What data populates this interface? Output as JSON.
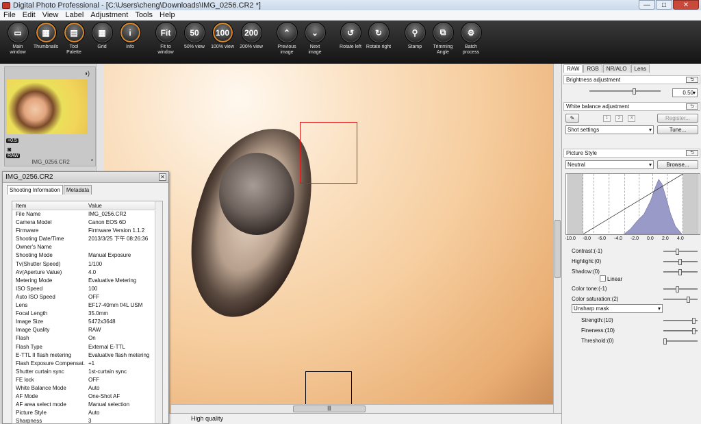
{
  "window": {
    "title": "Digital Photo Professional - [C:\\Users\\cheng\\Downloads\\IMG_0256.CR2 *]",
    "minimize": "—",
    "maximize": "□",
    "close": "✕"
  },
  "menu": [
    "File",
    "Edit",
    "View",
    "Label",
    "Adjustment",
    "Tools",
    "Help"
  ],
  "toolbar": [
    {
      "label": "Main\nwindow",
      "icon": "main-window-icon",
      "glyph": "▭"
    },
    {
      "label": "Thumbnails",
      "icon": "thumbnails-icon",
      "glyph": "▦",
      "active": true
    },
    {
      "label": "Tool\nPalette",
      "icon": "tool-palette-icon",
      "glyph": "▤",
      "active": true
    },
    {
      "label": "Grid",
      "icon": "grid-icon",
      "glyph": "▦"
    },
    {
      "label": "Info",
      "icon": "info-icon",
      "glyph": "i",
      "active": true
    },
    {
      "label": "Fit to\nwindow",
      "icon": "fit-to-window-icon",
      "glyph": "Fit"
    },
    {
      "label": "50% view",
      "icon": "zoom-50-icon",
      "glyph": "50"
    },
    {
      "label": "100% view",
      "icon": "zoom-100-icon",
      "glyph": "100",
      "active": true
    },
    {
      "label": "200% view",
      "icon": "zoom-200-icon",
      "glyph": "200"
    },
    {
      "label": "Previous\nimage",
      "icon": "previous-image-icon",
      "glyph": "⌃"
    },
    {
      "label": "Next\nimage",
      "icon": "next-image-icon",
      "glyph": "⌄"
    },
    {
      "label": "Rotate left",
      "icon": "rotate-left-icon",
      "glyph": "↺"
    },
    {
      "label": "Rotate right",
      "icon": "rotate-right-icon",
      "glyph": "↻"
    },
    {
      "label": "Stamp",
      "icon": "stamp-icon",
      "glyph": "⚲"
    },
    {
      "label": "Trimming\nAngle",
      "icon": "trimming-angle-icon",
      "glyph": "⧉"
    },
    {
      "label": "Batch\nprocess",
      "icon": "batch-process-icon",
      "glyph": "⚙"
    }
  ],
  "thumbnail": {
    "name": "IMG_0256.CR2",
    "exposure_badge": "+0.5",
    "raw_badge": "RAW",
    "star": "*"
  },
  "info_panel": {
    "title": "IMG_0256.CR2",
    "tabs": [
      "Shooting Information",
      "Metadata"
    ],
    "columns": [
      "Item",
      "Value"
    ],
    "rows": [
      [
        "File Name",
        "IMG_0256.CR2"
      ],
      [
        "Camera Model",
        "Canon EOS 6D"
      ],
      [
        "Firmware",
        "Firmware Version 1.1.2"
      ],
      [
        "Shooting Date/Time",
        "2013/3/25 下午 08:26:36"
      ],
      [
        "Owner's Name",
        ""
      ],
      [
        "Shooting Mode",
        "Manual Exposure"
      ],
      [
        "Tv(Shutter Speed)",
        "1/100"
      ],
      [
        "Av(Aperture Value)",
        "4.0"
      ],
      [
        "Metering Mode",
        "Evaluative Metering"
      ],
      [
        "ISO Speed",
        "100"
      ],
      [
        "Auto ISO Speed",
        "OFF"
      ],
      [
        "Lens",
        "EF17-40mm f/4L USM"
      ],
      [
        "Focal Length",
        "35.0mm"
      ],
      [
        "Image Size",
        "5472x3648"
      ],
      [
        "Image Quality",
        "RAW"
      ],
      [
        "Flash",
        "On"
      ],
      [
        "Flash Type",
        "External E-TTL"
      ],
      [
        "E-TTL II flash metering",
        "Evaluative flash metering"
      ],
      [
        "Flash Exposure Compensat...",
        "+1"
      ],
      [
        "Shutter curtain sync",
        "1st-curtain sync"
      ],
      [
        "FE lock",
        "OFF"
      ],
      [
        "White Balance Mode",
        "Auto"
      ],
      [
        "AF Mode",
        "One-Shot AF"
      ],
      [
        "AF area select mode",
        "Manual selection"
      ],
      [
        "Picture Style",
        "Auto"
      ],
      [
        "Sharpness",
        "3"
      ]
    ]
  },
  "status": {
    "quality": "High quality"
  },
  "hscroll_grip": "|||",
  "right_panel": {
    "tabs": [
      "RAW",
      "RGB",
      "NR/ALO",
      "Lens"
    ],
    "brightness": {
      "title": "Brightness adjustment",
      "value": "0.50",
      "reset": "⮌"
    },
    "white_balance": {
      "title": "White balance adjustment",
      "reset": "⮌",
      "buttons": [
        "1",
        "2",
        "3"
      ],
      "register": "Register...",
      "setting": "Shot settings",
      "tune": "Tune..."
    },
    "picture_style": {
      "title": "Picture Style",
      "reset": "⮌",
      "style": "Neutral",
      "browse": "Browse...",
      "ticks": [
        "-10.0",
        "-8.0",
        "-6.0",
        "-4.0",
        "-2.0",
        "0.0",
        "2.0",
        "4.0"
      ],
      "contrast": "Contrast:(-1)",
      "highlight": "Highlight:(0)",
      "shadow": "Shadow:(0)",
      "linear": "Linear",
      "color_tone": "Color tone:(-1)",
      "color_saturation": "Color saturation:(2)",
      "unsharp": "Unsharp mask",
      "strength": "Strength:(10)",
      "fineness": "Fineness:(10)",
      "threshold": "Threshold:(0)"
    }
  },
  "colors": {
    "toolbar_bg": "#1e1e1e",
    "accent_orange": "#d9892c",
    "focus_box": "#e01818",
    "histogram_fill": "#9a9ac8"
  }
}
